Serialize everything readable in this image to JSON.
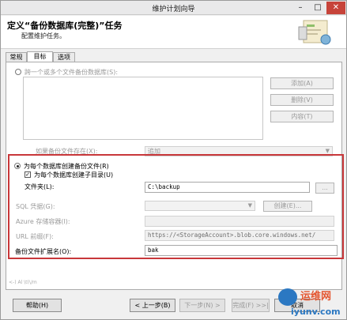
{
  "window": {
    "title": "维护计划向导",
    "min": "–",
    "max": "□",
    "close": "✕"
  },
  "header": {
    "title": "定义“备份数据库(完整)”任务",
    "subtitle": "配置维护任务。"
  },
  "tabs": [
    {
      "label": "常规"
    },
    {
      "label": "目标"
    },
    {
      "label": "选项"
    }
  ],
  "target": {
    "multi_file_radio": "跨一个或多个文件备份数据库(S):",
    "add_button": "添加(A)",
    "remove_button": "删除(V)",
    "contents_button": "内容(T)",
    "if_exists_label": "如果备份文件存在(X):",
    "if_exists_value": "追加",
    "per_db_radio": "为每个数据库创建备份文件(R)",
    "subdir_check": "为每个数据库创建子目录(U)",
    "folder_label": "文件夹(L):",
    "folder_value": "C:\\backup",
    "browse_button": "...",
    "sql_credential_label": "SQL 凭据(G):",
    "create_button": "创建(E)...",
    "azure_container_label": "Azure 存储容器(I):",
    "url_prefix_label": "URL 前缀(F):",
    "url_prefix_value": "https://<StorageAccount>.blob.core.windows.net/",
    "extension_label": "备份文件扩展名(O):",
    "extension_value": "bak"
  },
  "footer": {
    "partial_text": "<-) Al \\t(\\/m",
    "help_button": "帮助(H)",
    "back_button": "< 上一步(B)",
    "next_button": "下一步(N) >",
    "finish_button": "完成(F) >>|",
    "cancel_button": "取消"
  },
  "watermark": {
    "brand": "运维网",
    "url": "iyunv.com"
  },
  "colors": {
    "highlight_border": "#c8373a",
    "watermark_red": "#e4552f",
    "watermark_blue": "#2b78c2"
  }
}
